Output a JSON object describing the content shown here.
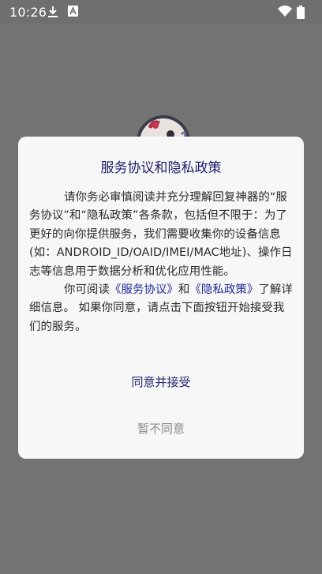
{
  "status_bar": {
    "time": "10:26",
    "icons": [
      "download-icon",
      "a-notification-icon",
      "wifi-icon",
      "battery-icon"
    ]
  },
  "dialog": {
    "title": "服务协议和隐私政策",
    "paragraph1": "请你务必审慎阅读并充分理解回复神器的“服务协议”和“隐私政策”各条款，包括但不限于：为了更好的向你提供服务，我们需要收集你的设备信息(如：ANDROID_ID/OAID/IMEI/MAC地址)、操作日志等信息用于数据分析和优化应用性能。",
    "paragraph2_prefix": "你可阅读",
    "service_link": "《服务协议》",
    "and": "和",
    "privacy_link": "《隐私政策》",
    "paragraph2_suffix": "了解详细信息。 如果你同意，请点击下面按钮开始接受我们的服务。",
    "accept_label": "同意并接受",
    "decline_label": "暂不同意"
  },
  "colors": {
    "overlay": "#737373",
    "dialog_bg": "#f7f7f7",
    "title": "#1d1e6b",
    "link": "#23289a",
    "decline": "#8a8a8a"
  }
}
